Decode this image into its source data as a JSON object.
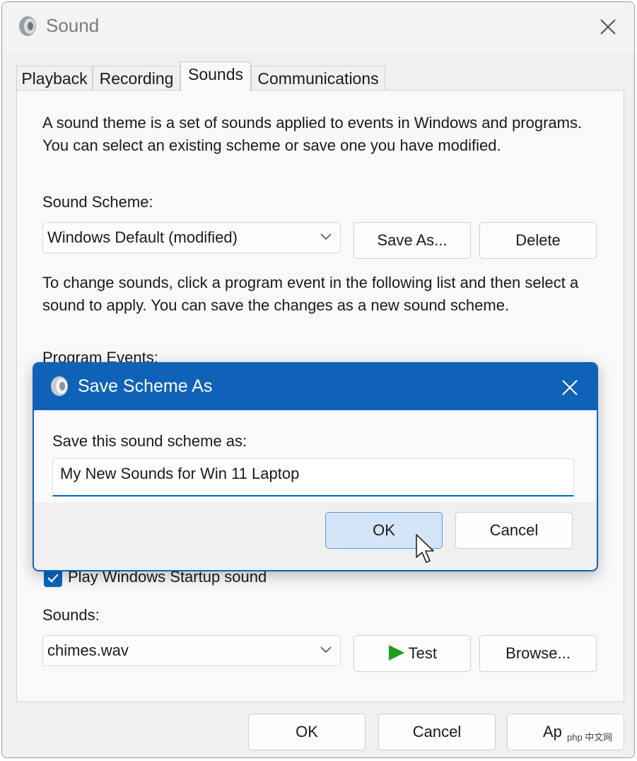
{
  "window": {
    "title": "Sound",
    "tabs": [
      {
        "label": "Playback"
      },
      {
        "label": "Recording"
      },
      {
        "label": "Sounds"
      },
      {
        "label": "Communications"
      }
    ],
    "active_tab": "Sounds"
  },
  "sounds_tab": {
    "description": "A sound theme is a set of sounds applied to events in Windows and programs.  You can select an existing scheme or save one you have modified.",
    "scheme_label": "Sound Scheme:",
    "scheme_value": "Windows Default (modified)",
    "save_as_label": "Save As...",
    "delete_label": "Delete",
    "instructions": "To change sounds, click a program event in the following list and then select a sound to apply.  You can save the changes as a new sound scheme.",
    "program_events_label": "Program Events:",
    "startup_checkbox_label": "Play Windows Startup sound",
    "startup_checked": true,
    "sounds_label": "Sounds:",
    "sound_value": "chimes.wav",
    "test_label": "Test",
    "browse_label": "Browse..."
  },
  "footer": {
    "ok_label": "OK",
    "cancel_label": "Cancel",
    "apply_label": "Ap"
  },
  "dialog": {
    "title": "Save Scheme As",
    "prompt": "Save this sound scheme as:",
    "input_value": "My New Sounds for Win 11 Laptop",
    "ok_label": "OK",
    "cancel_label": "Cancel"
  },
  "watermark": "php 中文网",
  "colors": {
    "dialog_title_bg": "#0f62b8",
    "accent": "#0067c0",
    "test_play_icon": "#1e9e1e"
  }
}
